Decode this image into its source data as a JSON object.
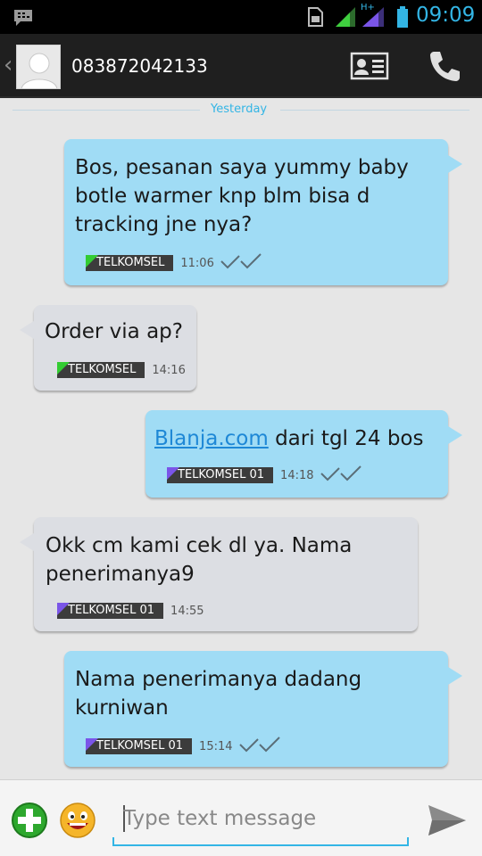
{
  "status_bar": {
    "time": "09:09",
    "network_label": "H+",
    "icons": [
      "bbm-icon",
      "sim-icon",
      "signal-icon",
      "battery-icon"
    ]
  },
  "action_bar": {
    "contact_name": "083872042133",
    "icons": [
      "back-chevron-icon",
      "avatar-icon",
      "contact-card-icon",
      "phone-icon"
    ]
  },
  "date_separator": "Yesterday",
  "messages": [
    {
      "direction": "outgoing",
      "text": "Bos, pesanan saya yummy baby\nbotle warmer knp blm bisa d\ntracking jne nya?",
      "carrier": "TELKOMSEL",
      "time": "11:06",
      "delivered": true
    },
    {
      "direction": "incoming",
      "text": "Order via ap?",
      "carrier": "TELKOMSEL",
      "time": "14:16",
      "delivered": false
    },
    {
      "direction": "outgoing",
      "link": "Blanja.com",
      "text": " dari tgl 24 bos",
      "carrier": "TELKOMSEL 01",
      "time": "14:18",
      "delivered": true
    },
    {
      "direction": "incoming",
      "text": "Okk cm kami cek dl ya. Nama\npenerimanya9",
      "carrier": "TELKOMSEL 01",
      "time": "14:55",
      "delivered": false
    },
    {
      "direction": "outgoing",
      "text": "Nama penerimanya dadang\nkurniwan",
      "carrier": "TELKOMSEL 01",
      "time": "15:14",
      "delivered": true
    }
  ],
  "compose": {
    "placeholder": "Type text message",
    "icons": [
      "add-attachment-icon",
      "emoji-icon",
      "send-icon"
    ]
  },
  "colors": {
    "accent": "#33b5e5",
    "outgoing_bubble": "#a0dcf5",
    "incoming_bubble": "#dcdee3",
    "sim1_marker": "#33cc33",
    "sim2_marker": "#7a55e8"
  }
}
